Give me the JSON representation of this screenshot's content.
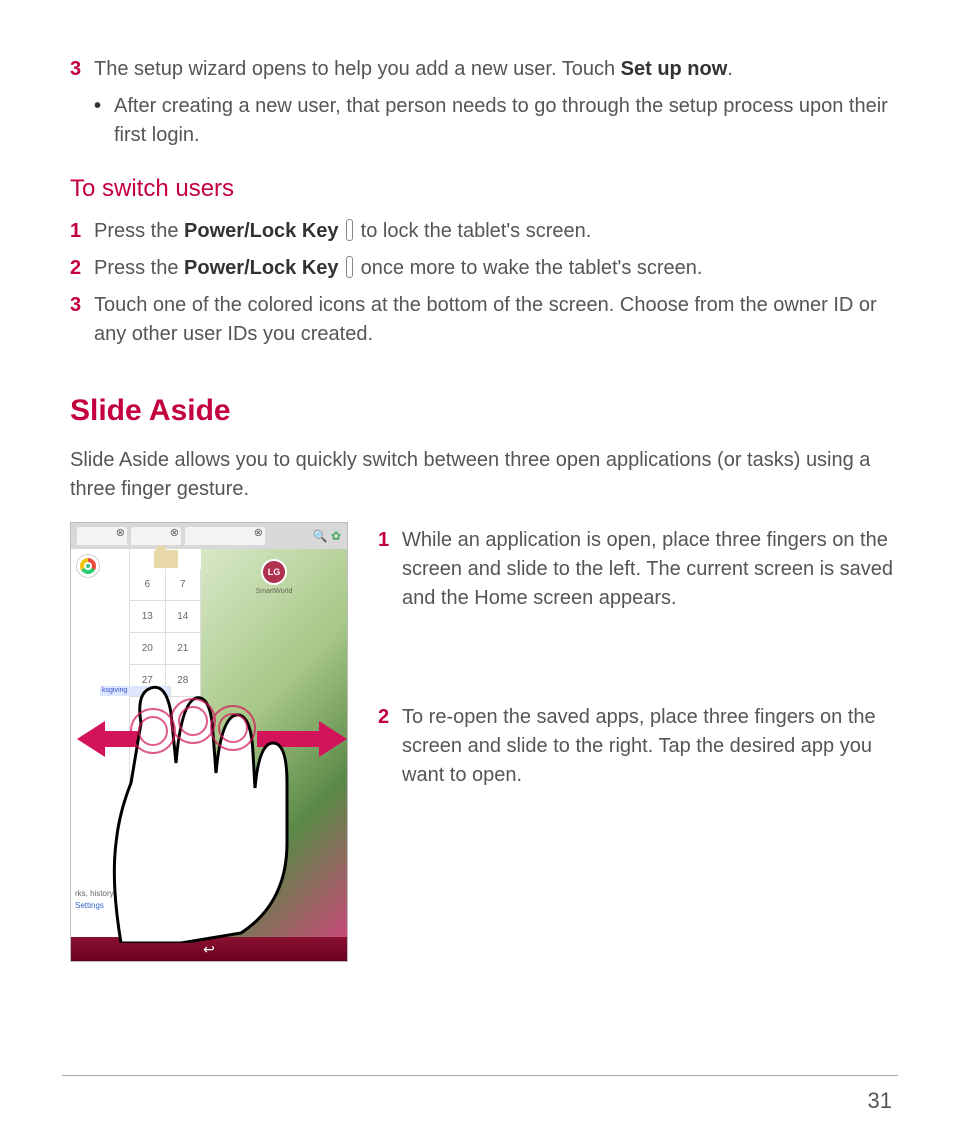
{
  "steps_top": {
    "num3": "3",
    "text3_a": "The setup wizard opens to help you add a new user. Touch ",
    "text3_bold": "Set up now",
    "text3_b": ".",
    "bullet_text": "After creating a new user, that person needs to go through the setup process upon their first login."
  },
  "switch_users": {
    "heading": "To switch users",
    "num1": "1",
    "s1_a": "Press the ",
    "s1_bold": "Power/Lock Key",
    "s1_b": " to lock the tablet's screen.",
    "num2": "2",
    "s2_a": "Press the ",
    "s2_bold": "Power/Lock Key",
    "s2_b": " once more to wake the tablet's screen.",
    "num3": "3",
    "s3": "Touch one of the colored icons at the bottom of the screen. Choose from the owner ID or any other user IDs you created."
  },
  "slide_aside": {
    "heading": "Slide Aside",
    "intro": "Slide Aside allows you to quickly switch between three open applications (or tasks) using a three finger gesture.",
    "num1": "1",
    "step1": "While an application is open, place three fingers on the screen and slide to the left. The current screen is saved and the Home screen appears.",
    "num2": "2",
    "step2": "To re-open the saved apps, place three fingers on the screen and slide to the right. Tap the desired app you want to open."
  },
  "illustration": {
    "cal": {
      "r1a": "6",
      "r1b": "7",
      "r2a": "13",
      "r2b": "14",
      "r3a": "20",
      "r3b": "21",
      "r4a": "27",
      "r4b": "28",
      "tag": "ksgiving"
    },
    "lg": "LG",
    "smartworld": "SmartWorld",
    "links_a": "rks, history,",
    "links_b": "Settings",
    "search": "🔍",
    "gear": "✿"
  },
  "page_number": "31"
}
